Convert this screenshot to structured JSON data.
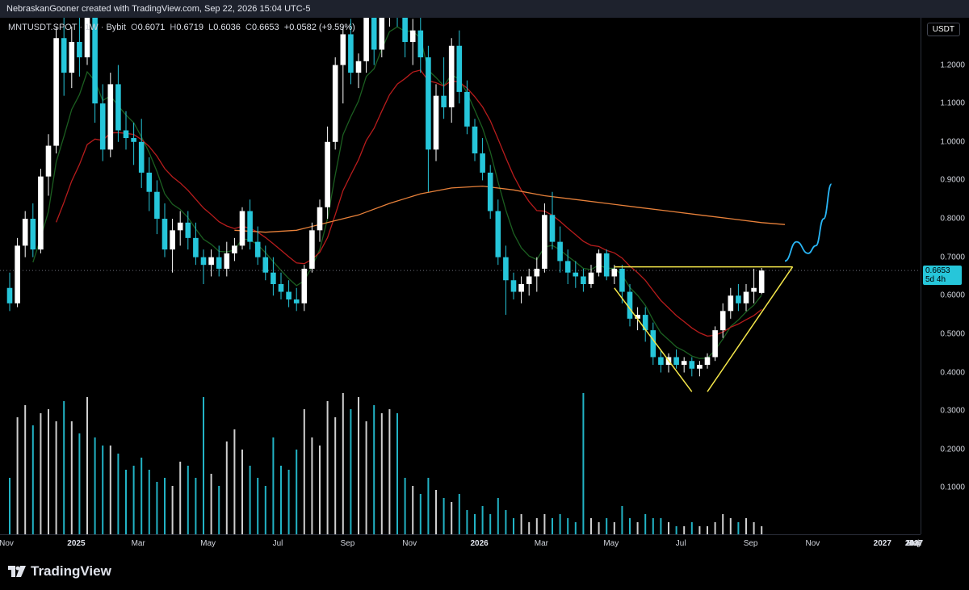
{
  "header": {
    "attribution": "NebraskanGooner created with TradingView.com, Sep 22, 2026 15:04 UTC-5"
  },
  "legend": {
    "symbol": "MNTUSDT.SPOT",
    "interval": "1W",
    "exchange": "Bybit",
    "open_label": "O",
    "open": "0.6071",
    "high_label": "H",
    "high": "0.6719",
    "low_label": "L",
    "low": "0.6036",
    "close_label": "C",
    "close": "0.6653",
    "change": "+0.0582 (+9.59%)"
  },
  "currency_button": "USDT",
  "current_price": {
    "value": "0.6653",
    "countdown": "5d 4h"
  },
  "brand": {
    "name": "TradingView"
  },
  "colors": {
    "bull": "#ffffff",
    "bear": "#26c6da",
    "ema_fast": "#1b5e20",
    "ema_mid": "#b71c1c",
    "ema_slow": "#e8813a",
    "pattern": "#f5e74a",
    "projection": "#29b6f6"
  },
  "chart_data": {
    "type": "candlestick",
    "symbol": "MNTUSDT",
    "y_axis": {
      "min": 0.0,
      "max": 1.4,
      "ticks": [
        "1.2000",
        "1.1000",
        "1.0000",
        "0.9000",
        "0.8000",
        "0.7000",
        "0.6000",
        "0.5000",
        "0.4000",
        "0.3000",
        "0.2000",
        "0.1000"
      ]
    },
    "x_axis": {
      "ticks": [
        {
          "label": "Nov",
          "week": 0
        },
        {
          "label": "2025",
          "week": 9,
          "bold": true
        },
        {
          "label": "Mar",
          "week": 17
        },
        {
          "label": "May",
          "week": 26
        },
        {
          "label": "Jul",
          "week": 35
        },
        {
          "label": "Sep",
          "week": 44
        },
        {
          "label": "Nov",
          "week": 52
        },
        {
          "label": "2026",
          "week": 61,
          "bold": true
        },
        {
          "label": "Mar",
          "week": 69
        },
        {
          "label": "May",
          "week": 78
        },
        {
          "label": "Jul",
          "week": 87
        },
        {
          "label": "Sep",
          "week": 96
        },
        {
          "label": "Nov",
          "week": 104
        },
        {
          "label": "2027",
          "week": 113,
          "bold": true
        },
        {
          "label": "Mar",
          "week": 121
        },
        {
          "label": "May",
          "week": 130
        },
        {
          "label": "Jul",
          "week": 139
        },
        {
          "label": "Sep",
          "week": 148
        },
        {
          "label": "Nov",
          "week": 156
        },
        {
          "label": "2027",
          "week": 165,
          "bold": true
        }
      ]
    },
    "candles": [
      {
        "o": 0.62,
        "h": 0.66,
        "l": 0.56,
        "c": 0.58,
        "v": 0.14
      },
      {
        "o": 0.58,
        "h": 0.75,
        "l": 0.57,
        "c": 0.73,
        "v": 0.29
      },
      {
        "o": 0.73,
        "h": 0.82,
        "l": 0.7,
        "c": 0.8,
        "v": 0.32
      },
      {
        "o": 0.8,
        "h": 0.84,
        "l": 0.7,
        "c": 0.72,
        "v": 0.27
      },
      {
        "o": 0.72,
        "h": 0.93,
        "l": 0.71,
        "c": 0.91,
        "v": 0.3
      },
      {
        "o": 0.91,
        "h": 1.02,
        "l": 0.86,
        "c": 0.99,
        "v": 0.31
      },
      {
        "o": 0.99,
        "h": 1.3,
        "l": 0.97,
        "c": 1.27,
        "v": 0.28
      },
      {
        "o": 1.27,
        "h": 1.35,
        "l": 1.12,
        "c": 1.18,
        "v": 0.33
      },
      {
        "o": 1.18,
        "h": 1.3,
        "l": 1.14,
        "c": 1.26,
        "v": 0.28
      },
      {
        "o": 1.26,
        "h": 1.35,
        "l": 1.17,
        "c": 1.22,
        "v": 0.25
      },
      {
        "o": 1.22,
        "h": 1.38,
        "l": 1.2,
        "c": 1.33,
        "v": 0.34
      },
      {
        "o": 1.33,
        "h": 1.36,
        "l": 1.05,
        "c": 1.1,
        "v": 0.24
      },
      {
        "o": 1.1,
        "h": 1.15,
        "l": 0.95,
        "c": 0.98,
        "v": 0.22
      },
      {
        "o": 0.98,
        "h": 1.18,
        "l": 0.96,
        "c": 1.15,
        "v": 0.22
      },
      {
        "o": 1.15,
        "h": 1.2,
        "l": 1.0,
        "c": 1.03,
        "v": 0.2
      },
      {
        "o": 1.03,
        "h": 1.08,
        "l": 0.98,
        "c": 1.01,
        "v": 0.16
      },
      {
        "o": 1.01,
        "h": 1.05,
        "l": 0.94,
        "c": 1.0,
        "v": 0.17
      },
      {
        "o": 1.0,
        "h": 1.06,
        "l": 0.88,
        "c": 0.92,
        "v": 0.19
      },
      {
        "o": 0.92,
        "h": 0.96,
        "l": 0.82,
        "c": 0.87,
        "v": 0.16
      },
      {
        "o": 0.87,
        "h": 0.9,
        "l": 0.76,
        "c": 0.8,
        "v": 0.13
      },
      {
        "o": 0.8,
        "h": 0.84,
        "l": 0.7,
        "c": 0.72,
        "v": 0.14
      },
      {
        "o": 0.72,
        "h": 0.8,
        "l": 0.66,
        "c": 0.77,
        "v": 0.12
      },
      {
        "o": 0.77,
        "h": 0.82,
        "l": 0.73,
        "c": 0.79,
        "v": 0.18
      },
      {
        "o": 0.79,
        "h": 0.82,
        "l": 0.72,
        "c": 0.75,
        "v": 0.17
      },
      {
        "o": 0.75,
        "h": 0.79,
        "l": 0.68,
        "c": 0.7,
        "v": 0.14
      },
      {
        "o": 0.7,
        "h": 0.72,
        "l": 0.63,
        "c": 0.68,
        "v": 0.34
      },
      {
        "o": 0.68,
        "h": 0.72,
        "l": 0.65,
        "c": 0.7,
        "v": 0.15
      },
      {
        "o": 0.7,
        "h": 0.73,
        "l": 0.65,
        "c": 0.67,
        "v": 0.12
      },
      {
        "o": 0.67,
        "h": 0.74,
        "l": 0.65,
        "c": 0.71,
        "v": 0.23
      },
      {
        "o": 0.71,
        "h": 0.75,
        "l": 0.69,
        "c": 0.73,
        "v": 0.26
      },
      {
        "o": 0.73,
        "h": 0.83,
        "l": 0.72,
        "c": 0.82,
        "v": 0.21
      },
      {
        "o": 0.82,
        "h": 0.85,
        "l": 0.72,
        "c": 0.74,
        "v": 0.17
      },
      {
        "o": 0.74,
        "h": 0.78,
        "l": 0.68,
        "c": 0.7,
        "v": 0.14
      },
      {
        "o": 0.7,
        "h": 0.73,
        "l": 0.64,
        "c": 0.66,
        "v": 0.12
      },
      {
        "o": 0.66,
        "h": 0.7,
        "l": 0.6,
        "c": 0.63,
        "v": 0.24
      },
      {
        "o": 0.63,
        "h": 0.66,
        "l": 0.59,
        "c": 0.61,
        "v": 0.17
      },
      {
        "o": 0.61,
        "h": 0.64,
        "l": 0.57,
        "c": 0.59,
        "v": 0.16
      },
      {
        "o": 0.59,
        "h": 0.62,
        "l": 0.56,
        "c": 0.58,
        "v": 0.21
      },
      {
        "o": 0.58,
        "h": 0.68,
        "l": 0.56,
        "c": 0.67,
        "v": 0.31
      },
      {
        "o": 0.67,
        "h": 0.79,
        "l": 0.66,
        "c": 0.77,
        "v": 0.24
      },
      {
        "o": 0.77,
        "h": 0.85,
        "l": 0.74,
        "c": 0.83,
        "v": 0.22
      },
      {
        "o": 0.83,
        "h": 1.04,
        "l": 0.8,
        "c": 1.0,
        "v": 0.33
      },
      {
        "o": 1.0,
        "h": 1.22,
        "l": 0.98,
        "c": 1.2,
        "v": 0.29
      },
      {
        "o": 1.2,
        "h": 1.3,
        "l": 1.1,
        "c": 1.28,
        "v": 0.35
      },
      {
        "o": 1.28,
        "h": 1.32,
        "l": 1.15,
        "c": 1.18,
        "v": 0.31
      },
      {
        "o": 1.18,
        "h": 1.23,
        "l": 1.14,
        "c": 1.21,
        "v": 0.34
      },
      {
        "o": 1.21,
        "h": 1.38,
        "l": 1.18,
        "c": 1.33,
        "v": 0.28
      },
      {
        "o": 1.33,
        "h": 1.42,
        "l": 1.2,
        "c": 1.24,
        "v": 0.32
      },
      {
        "o": 1.24,
        "h": 1.42,
        "l": 1.22,
        "c": 1.37,
        "v": 0.3
      },
      {
        "o": 1.37,
        "h": 1.42,
        "l": 1.3,
        "c": 1.4,
        "v": 0.31
      },
      {
        "o": 1.4,
        "h": 1.42,
        "l": 1.3,
        "c": 1.33,
        "v": 0.3
      },
      {
        "o": 1.33,
        "h": 1.4,
        "l": 1.22,
        "c": 1.26,
        "v": 0.14
      },
      {
        "o": 1.26,
        "h": 1.32,
        "l": 1.2,
        "c": 1.29,
        "v": 0.12
      },
      {
        "o": 1.29,
        "h": 1.36,
        "l": 1.18,
        "c": 1.22,
        "v": 0.1
      },
      {
        "o": 1.22,
        "h": 1.25,
        "l": 0.87,
        "c": 0.98,
        "v": 0.14
      },
      {
        "o": 0.98,
        "h": 1.15,
        "l": 0.95,
        "c": 1.12,
        "v": 0.11
      },
      {
        "o": 1.12,
        "h": 1.22,
        "l": 1.06,
        "c": 1.09,
        "v": 0.09
      },
      {
        "o": 1.09,
        "h": 1.27,
        "l": 1.05,
        "c": 1.25,
        "v": 0.08
      },
      {
        "o": 1.25,
        "h": 1.29,
        "l": 1.1,
        "c": 1.13,
        "v": 0.1
      },
      {
        "o": 1.13,
        "h": 1.16,
        "l": 1.02,
        "c": 1.04,
        "v": 0.06
      },
      {
        "o": 1.04,
        "h": 1.06,
        "l": 0.95,
        "c": 0.97,
        "v": 0.05
      },
      {
        "o": 0.97,
        "h": 1.01,
        "l": 0.9,
        "c": 0.92,
        "v": 0.07
      },
      {
        "o": 0.92,
        "h": 0.94,
        "l": 0.8,
        "c": 0.82,
        "v": 0.05
      },
      {
        "o": 0.82,
        "h": 0.85,
        "l": 0.68,
        "c": 0.7,
        "v": 0.09
      },
      {
        "o": 0.7,
        "h": 0.73,
        "l": 0.55,
        "c": 0.64,
        "v": 0.06
      },
      {
        "o": 0.64,
        "h": 0.66,
        "l": 0.59,
        "c": 0.61,
        "v": 0.04
      },
      {
        "o": 0.61,
        "h": 0.65,
        "l": 0.58,
        "c": 0.63,
        "v": 0.05
      },
      {
        "o": 0.63,
        "h": 0.67,
        "l": 0.6,
        "c": 0.65,
        "v": 0.03
      },
      {
        "o": 0.65,
        "h": 0.7,
        "l": 0.61,
        "c": 0.67,
        "v": 0.04
      },
      {
        "o": 0.67,
        "h": 0.84,
        "l": 0.66,
        "c": 0.81,
        "v": 0.05
      },
      {
        "o": 0.81,
        "h": 0.87,
        "l": 0.72,
        "c": 0.74,
        "v": 0.04
      },
      {
        "o": 0.74,
        "h": 0.78,
        "l": 0.66,
        "c": 0.69,
        "v": 0.05
      },
      {
        "o": 0.69,
        "h": 0.72,
        "l": 0.63,
        "c": 0.66,
        "v": 0.04
      },
      {
        "o": 0.66,
        "h": 0.69,
        "l": 0.62,
        "c": 0.65,
        "v": 0.03
      },
      {
        "o": 0.65,
        "h": 0.67,
        "l": 0.61,
        "c": 0.63,
        "v": 0.35
      },
      {
        "o": 0.63,
        "h": 0.68,
        "l": 0.62,
        "c": 0.66,
        "v": 0.04
      },
      {
        "o": 0.66,
        "h": 0.72,
        "l": 0.65,
        "c": 0.71,
        "v": 0.03
      },
      {
        "o": 0.71,
        "h": 0.72,
        "l": 0.64,
        "c": 0.65,
        "v": 0.04
      },
      {
        "o": 0.65,
        "h": 0.68,
        "l": 0.63,
        "c": 0.67,
        "v": 0.03
      },
      {
        "o": 0.67,
        "h": 0.68,
        "l": 0.58,
        "c": 0.61,
        "v": 0.07
      },
      {
        "o": 0.61,
        "h": 0.63,
        "l": 0.52,
        "c": 0.54,
        "v": 0.04
      },
      {
        "o": 0.54,
        "h": 0.57,
        "l": 0.51,
        "c": 0.55,
        "v": 0.03
      },
      {
        "o": 0.55,
        "h": 0.57,
        "l": 0.48,
        "c": 0.51,
        "v": 0.05
      },
      {
        "o": 0.51,
        "h": 0.53,
        "l": 0.42,
        "c": 0.44,
        "v": 0.04
      },
      {
        "o": 0.44,
        "h": 0.46,
        "l": 0.4,
        "c": 0.42,
        "v": 0.04
      },
      {
        "o": 0.42,
        "h": 0.45,
        "l": 0.4,
        "c": 0.44,
        "v": 0.03
      },
      {
        "o": 0.44,
        "h": 0.46,
        "l": 0.41,
        "c": 0.42,
        "v": 0.02
      },
      {
        "o": 0.42,
        "h": 0.44,
        "l": 0.4,
        "c": 0.43,
        "v": 0.02
      },
      {
        "o": 0.43,
        "h": 0.44,
        "l": 0.39,
        "c": 0.41,
        "v": 0.03
      },
      {
        "o": 0.41,
        "h": 0.43,
        "l": 0.39,
        "c": 0.42,
        "v": 0.02
      },
      {
        "o": 0.42,
        "h": 0.45,
        "l": 0.41,
        "c": 0.44,
        "v": 0.02
      },
      {
        "o": 0.44,
        "h": 0.52,
        "l": 0.43,
        "c": 0.51,
        "v": 0.03
      },
      {
        "o": 0.51,
        "h": 0.58,
        "l": 0.49,
        "c": 0.56,
        "v": 0.05
      },
      {
        "o": 0.56,
        "h": 0.62,
        "l": 0.54,
        "c": 0.6,
        "v": 0.04
      },
      {
        "o": 0.6,
        "h": 0.63,
        "l": 0.56,
        "c": 0.58,
        "v": 0.03
      },
      {
        "o": 0.58,
        "h": 0.63,
        "l": 0.56,
        "c": 0.61,
        "v": 0.04
      },
      {
        "o": 0.61,
        "h": 0.67,
        "l": 0.58,
        "c": 0.62,
        "v": 0.03
      },
      {
        "o": 0.6071,
        "h": 0.6719,
        "l": 0.6036,
        "c": 0.6653,
        "v": 0.02
      }
    ],
    "ema_slow": [
      [
        29,
        0.77
      ],
      [
        33,
        0.765
      ],
      [
        37,
        0.77
      ],
      [
        41,
        0.79
      ],
      [
        45,
        0.81
      ],
      [
        49,
        0.84
      ],
      [
        53,
        0.865
      ],
      [
        57,
        0.88
      ],
      [
        61,
        0.885
      ],
      [
        65,
        0.875
      ],
      [
        69,
        0.86
      ],
      [
        73,
        0.85
      ],
      [
        77,
        0.84
      ],
      [
        81,
        0.83
      ],
      [
        85,
        0.82
      ],
      [
        89,
        0.81
      ],
      [
        93,
        0.8
      ],
      [
        97,
        0.79
      ],
      [
        100,
        0.785
      ]
    ],
    "pattern_lines": [
      {
        "points": [
          [
            78,
            0.675
          ],
          [
            101,
            0.675
          ]
        ]
      },
      {
        "points": [
          [
            78,
            0.62
          ],
          [
            88,
            0.35
          ]
        ]
      },
      {
        "points": [
          [
            90,
            0.35
          ],
          [
            101,
            0.675
          ]
        ]
      }
    ],
    "projection": [
      [
        100,
        0.69
      ],
      [
        101.5,
        0.74
      ],
      [
        103,
        0.71
      ],
      [
        104,
        0.73
      ],
      [
        105,
        0.8
      ],
      [
        106,
        0.89
      ]
    ]
  }
}
